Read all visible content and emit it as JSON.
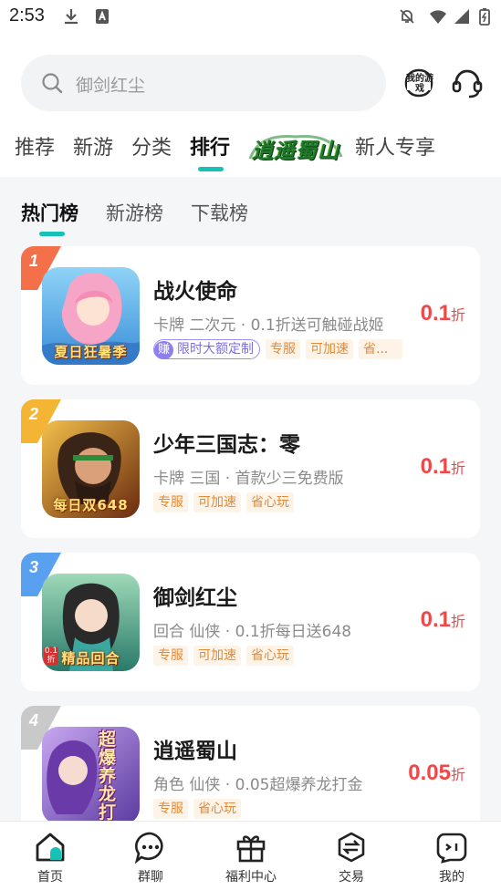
{
  "status_bar": {
    "time": "2:53",
    "icons": [
      "download-icon",
      "sim-icon",
      "mute-icon",
      "wifi-icon",
      "signal-icon",
      "battery-icon"
    ]
  },
  "search": {
    "placeholder": "御剑红尘",
    "icon": "search-icon"
  },
  "header_icons": {
    "my_games_label": "我的游戏",
    "customer_service": "headset-icon"
  },
  "nav_tabs": [
    {
      "label": "推荐"
    },
    {
      "label": "新游"
    },
    {
      "label": "分类"
    },
    {
      "label": "排行",
      "active": true
    },
    {
      "label": "逍遥蜀山",
      "style": "logo"
    },
    {
      "label": "新人专享"
    }
  ],
  "sub_tabs": [
    {
      "label": "热门榜",
      "active": true
    },
    {
      "label": "新游榜"
    },
    {
      "label": "下载榜"
    }
  ],
  "games": [
    {
      "rank": "1",
      "rank_color": "#f4704a",
      "name": "战火使命",
      "desc": "卡牌 二次元 · 0.1折送可触碰战姬",
      "icon_banner": "夏日狂暑季",
      "earn_badge": "赚",
      "earn_text": "限时大额定制",
      "tags": [
        "专服",
        "可加速",
        "省..."
      ],
      "price": "0.1",
      "price_unit": "折"
    },
    {
      "rank": "2",
      "rank_color": "#f5b534",
      "name": "少年三国志：零",
      "desc": "卡牌 三国 · 首款少三免费版",
      "icon_banner": "每日双648",
      "tags": [
        "专服",
        "可加速",
        "省心玩"
      ],
      "price": "0.1",
      "price_unit": "折"
    },
    {
      "rank": "3",
      "rank_color": "#5aa0f0",
      "name": "御剑红尘",
      "desc": "回合 仙侠 · 0.1折每日送648",
      "icon_banner": "精品回合",
      "icon_corner": "0.1折",
      "tags": [
        "专服",
        "可加速",
        "省心玩"
      ],
      "price": "0.1",
      "price_unit": "折"
    },
    {
      "rank": "4",
      "rank_color": "#c9c9c9",
      "name": "逍遥蜀山",
      "desc": "角色 仙侠 · 0.05超爆养龙打金",
      "icon_banner": "超爆养龙打金",
      "tags": [
        "专服",
        "省心玩"
      ],
      "price": "0.05",
      "price_unit": "折"
    }
  ],
  "bottom_nav": [
    {
      "label": "首页",
      "icon": "home-icon",
      "active": true
    },
    {
      "label": "群聊",
      "icon": "chat-icon"
    },
    {
      "label": "福利中心",
      "icon": "gift-icon"
    },
    {
      "label": "交易",
      "icon": "trade-icon"
    },
    {
      "label": "我的",
      "icon": "profile-icon"
    }
  ],
  "colors": {
    "accent": "#16c2b5",
    "price": "#f04848",
    "tag_text": "#e08a3a",
    "earn": "#8d7ff0"
  }
}
